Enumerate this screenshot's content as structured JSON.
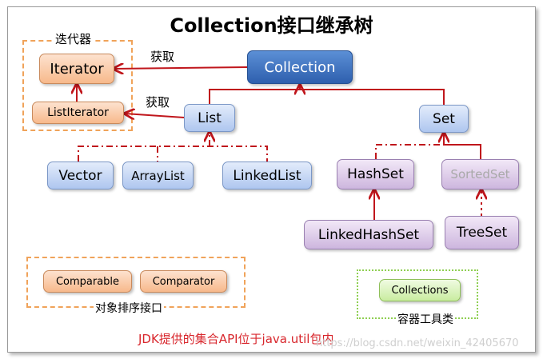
{
  "title": "Collection接口继承树",
  "nodes": {
    "iterator": "Iterator",
    "list_iterator": "ListIterator",
    "collection": "Collection",
    "list": "List",
    "set": "Set",
    "vector": "Vector",
    "array_list": "ArrayList",
    "linked_list": "LinkedList",
    "hash_set": "HashSet",
    "sorted_set": "SortedSet",
    "linked_hash_set": "LinkedHashSet",
    "tree_set": "TreeSet",
    "comparable": "Comparable",
    "comparator": "Comparator",
    "collections": "Collections"
  },
  "groups": {
    "iterator_group": "迭代器",
    "sort_group": "对象排序接口",
    "tools_group": "容器工具类"
  },
  "edge_labels": {
    "obtain_1": "获取",
    "obtain_2": "获取"
  },
  "footer": "JDK提供的集合API位于java.util包内",
  "watermark": "https://blog.csdn.net/weixin_42405670",
  "colors": {
    "arrow": "#c0161c",
    "group_border": "#f0a35a",
    "tools_border": "#8fcf52",
    "footer": "#d8262c"
  }
}
